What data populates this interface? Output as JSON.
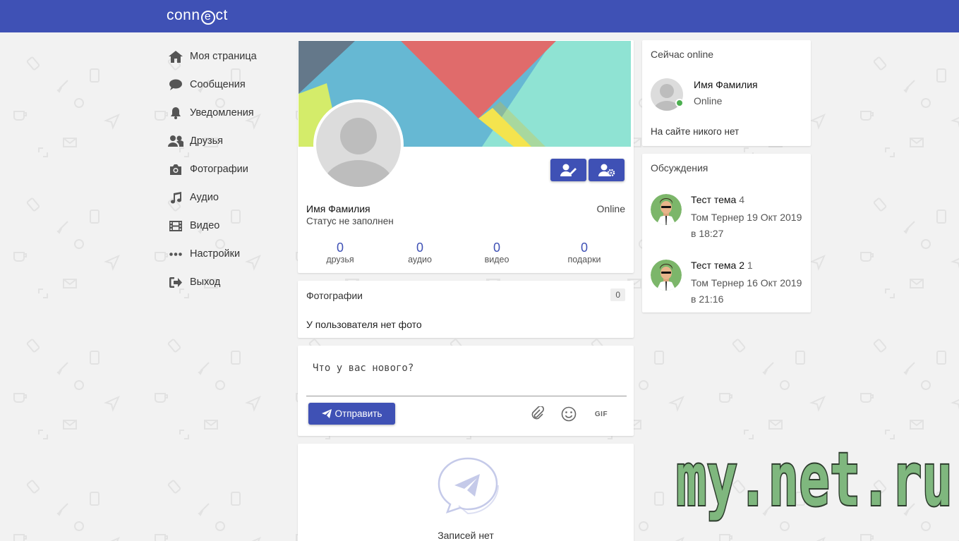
{
  "app": {
    "logo": "connect"
  },
  "sidebar": {
    "items": [
      {
        "label": "Моя страница",
        "icon": "home-icon"
      },
      {
        "label": "Сообщения",
        "icon": "chat-bubble-icon"
      },
      {
        "label": "Уведомления",
        "icon": "bell-icon"
      },
      {
        "label": "Друзья",
        "icon": "users-icon"
      },
      {
        "label": "Фотографии",
        "icon": "camera-icon"
      },
      {
        "label": "Аудио",
        "icon": "music-icon"
      },
      {
        "label": "Видео",
        "icon": "film-icon"
      },
      {
        "label": "Настройки",
        "icon": "dots-icon"
      },
      {
        "label": "Выход",
        "icon": "logout-icon"
      }
    ]
  },
  "profile": {
    "name": "Имя Фамилия",
    "status": "Статус не заполнен",
    "online": "Online",
    "stats": [
      {
        "value": "0",
        "label": "друзья"
      },
      {
        "value": "0",
        "label": "аудио"
      },
      {
        "value": "0",
        "label": "видео"
      },
      {
        "value": "0",
        "label": "подарки"
      }
    ]
  },
  "photos": {
    "title": "Фотографии",
    "count": "0",
    "empty": "У пользователя нет фото"
  },
  "post": {
    "placeholder": "Что у вас нового?",
    "send_label": "Отправить",
    "gif_label": "GIF"
  },
  "wall": {
    "empty": "Записей нет"
  },
  "online_now": {
    "title": "Сейчас online",
    "user_name": "Имя Фамилия",
    "user_state": "Online",
    "none": "На сайте никого нет"
  },
  "discussions": {
    "title": "Обсуждения",
    "items": [
      {
        "title": "Тест тема",
        "count": "4",
        "meta": "Том Тернер 19 Окт 2019 в 18:27"
      },
      {
        "title": "Тест тема 2",
        "count": "1",
        "meta": "Том Тернер 16 Окт 2019 в 21:16"
      }
    ]
  },
  "watermark": {
    "text": "my.net.ru"
  },
  "colors": {
    "primary": "#3f51b5",
    "online": "#4caf50",
    "watermark_fill": "#7fb77e"
  }
}
